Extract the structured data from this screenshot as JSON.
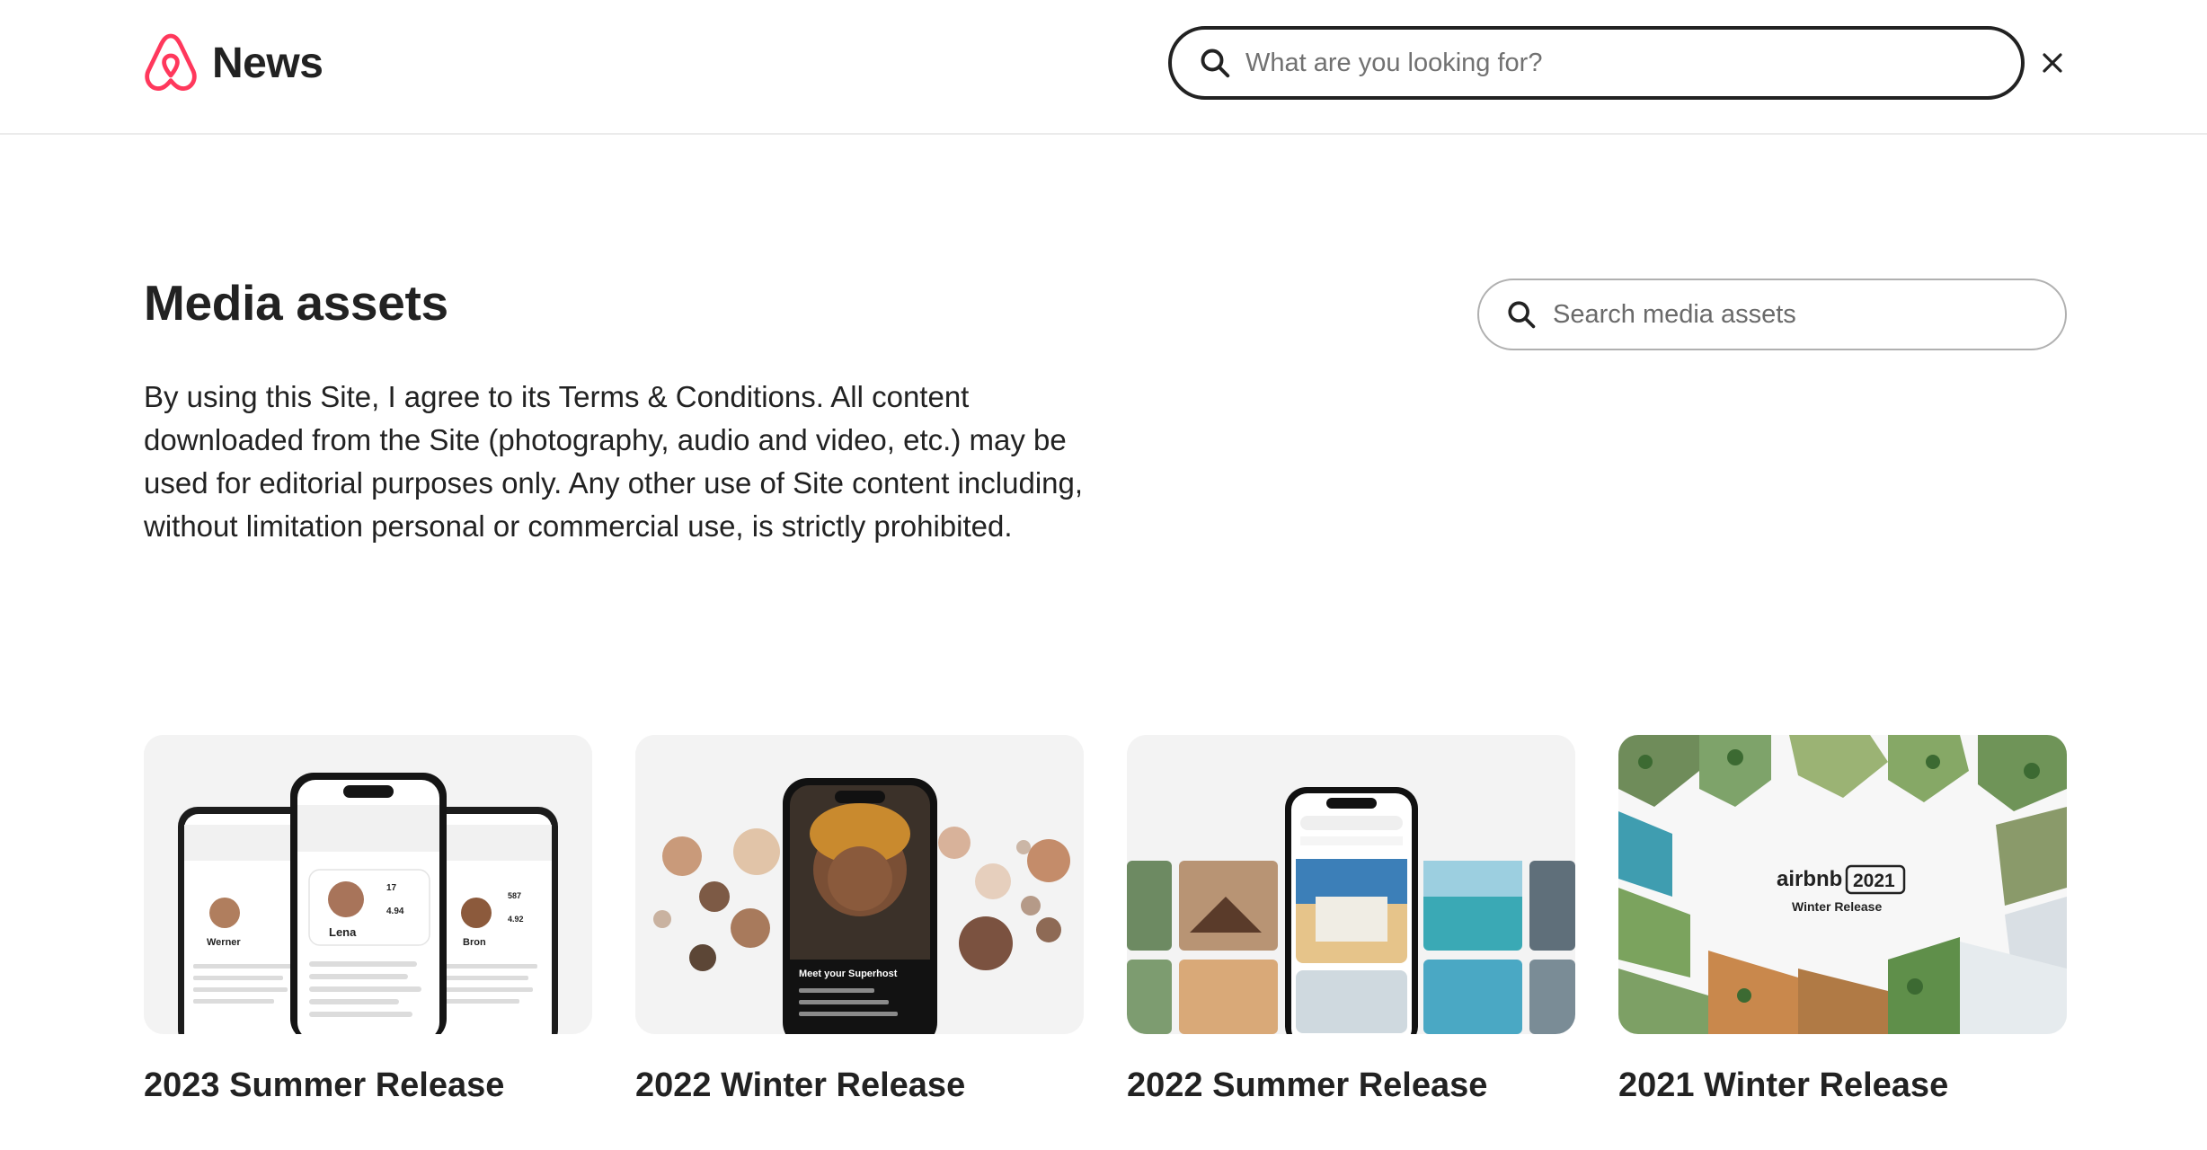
{
  "header": {
    "brand_label": "News",
    "search_placeholder": "What are you looking for?"
  },
  "media": {
    "title": "Media assets",
    "search_placeholder": "Search media assets",
    "disclaimer": "By using this Site, I agree to its Terms & Conditions. All content downloaded from the Site (photography, audio and video, etc.) may be used for editorial purposes only. Any other use of Site content including, without limitation personal or commercial use, is strictly prohibited."
  },
  "cards": [
    {
      "title": "2023 Summer Release",
      "phone_labels": {
        "left_name": "Werner",
        "center_name": "Lena",
        "right_name": "Bron",
        "rating": "4.94",
        "reviews": "17",
        "right_rating": "4.92",
        "right_reviews": "587"
      }
    },
    {
      "title": "2022 Winter Release",
      "phone_labels": {
        "caption": "Meet your Superhost"
      }
    },
    {
      "title": "2022 Summer Release"
    },
    {
      "title": "2021 Winter Release",
      "logo_text": "airbnb",
      "logo_year": "2021",
      "logo_sub": "Winter Release"
    }
  ],
  "colors": {
    "brand": "#FF385C",
    "text": "#222222",
    "muted": "#717171",
    "border": "#B0B0B0"
  }
}
